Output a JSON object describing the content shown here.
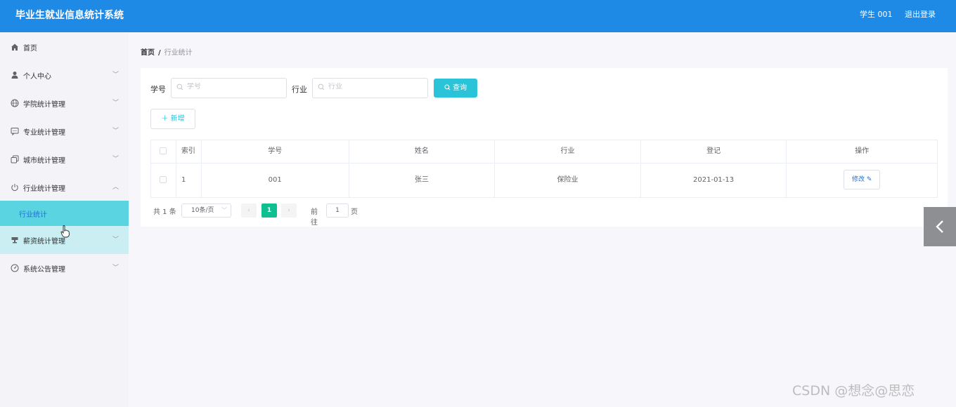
{
  "header": {
    "title": "毕业生就业信息统计系统",
    "user": "学生 001",
    "logout": "退出登录"
  },
  "sidebar": {
    "items": [
      {
        "label": "首页",
        "icon": "home-icon",
        "expandable": false
      },
      {
        "label": "个人中心",
        "icon": "user-icon",
        "expandable": true
      },
      {
        "label": "学院统计管理",
        "icon": "globe-icon",
        "expandable": true
      },
      {
        "label": "专业统计管理",
        "icon": "chat-icon",
        "expandable": true
      },
      {
        "label": "城市统计管理",
        "icon": "copy-icon",
        "expandable": true
      },
      {
        "label": "行业统计管理",
        "icon": "power-icon",
        "expandable": true,
        "expanded": true
      },
      {
        "label": "行业统计",
        "icon": "",
        "sub": true,
        "active": true
      },
      {
        "label": "薪资统计管理",
        "icon": "cup-icon",
        "expandable": true,
        "hover": true
      },
      {
        "label": "系统公告管理",
        "icon": "gauge-icon",
        "expandable": true
      }
    ]
  },
  "breadcrumb": {
    "home": "首页",
    "separator": "/",
    "current": "行业统计"
  },
  "search": {
    "label_id": "学号",
    "placeholder_id": "学号",
    "label_industry": "行业",
    "placeholder_industry": "行业",
    "query_label": "查询"
  },
  "toolbar": {
    "add_label": "新增"
  },
  "table": {
    "headers": [
      "索引",
      "学号",
      "姓名",
      "行业",
      "登记",
      "操作"
    ],
    "rows": [
      {
        "index": "1",
        "student_id": "001",
        "name": "张三",
        "industry": "保险业",
        "date": "2021-01-13",
        "action": "修改"
      }
    ]
  },
  "pagination": {
    "total": "共 1 条",
    "page_size": "10条/页",
    "current_page": "1",
    "goto_label": "前往",
    "goto_value": "1",
    "page_suffix": "页"
  },
  "watermark": "CSDN @想念@思恋",
  "colors": {
    "header": "#1f89e6",
    "accent": "#2bc3d8",
    "active_page": "#0fbf8f",
    "active_menu": "#5bd4e2"
  }
}
